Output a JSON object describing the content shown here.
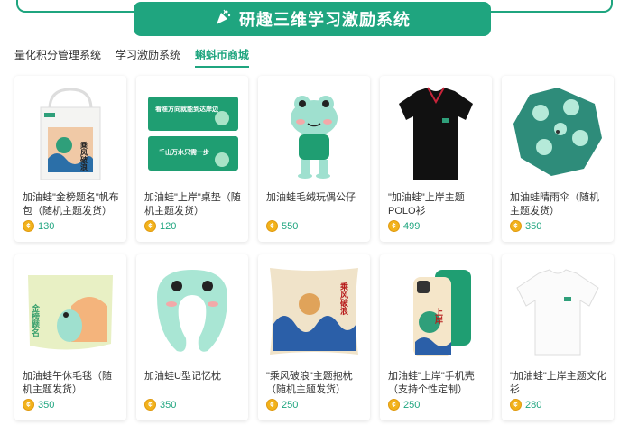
{
  "header": {
    "title": "研趣三维学习激励系统",
    "icon": "party-popper-icon"
  },
  "tabs": [
    {
      "label": "量化积分管理系统",
      "active": false
    },
    {
      "label": "学习激励系统",
      "active": false
    },
    {
      "label": "蝌蚪币商城",
      "active": true
    }
  ],
  "products": [
    {
      "name": "加油蛙\"金榜题名\"帆布包（随机主题发货）",
      "price": "130"
    },
    {
      "name": "加油蛙\"上岸\"桌垫（随机主题发货）",
      "price": "120"
    },
    {
      "name": "加油蛙毛绒玩偶公仔",
      "price": "550"
    },
    {
      "name": "\"加油蛙\"上岸主题POLO衫",
      "price": "499"
    },
    {
      "name": "加油蛙晴雨伞（随机主题发货）",
      "price": "350"
    },
    {
      "name": "加油蛙午休毛毯（随机主题发货）",
      "price": "350"
    },
    {
      "name": "加油蛙U型记忆枕",
      "price": "350"
    },
    {
      "name": "\"乘风破浪\"主题抱枕（随机主题发货）",
      "price": "250"
    },
    {
      "name": "加油蛙\"上岸\"手机壳（支持个性定制）",
      "price": "250"
    },
    {
      "name": "\"加油蛙\"上岸主题文化衫",
      "price": "280"
    }
  ],
  "image_text": {
    "bag": "乘风破浪",
    "mat_top": "看准方向就能到达岸边",
    "mat_bottom": "千山万水只需一步",
    "blanket": "金榜题名",
    "pillow": "乘风破浪",
    "phone": "上岸"
  },
  "colors": {
    "accent": "#1fa57f",
    "coin": "#f2b21b"
  }
}
